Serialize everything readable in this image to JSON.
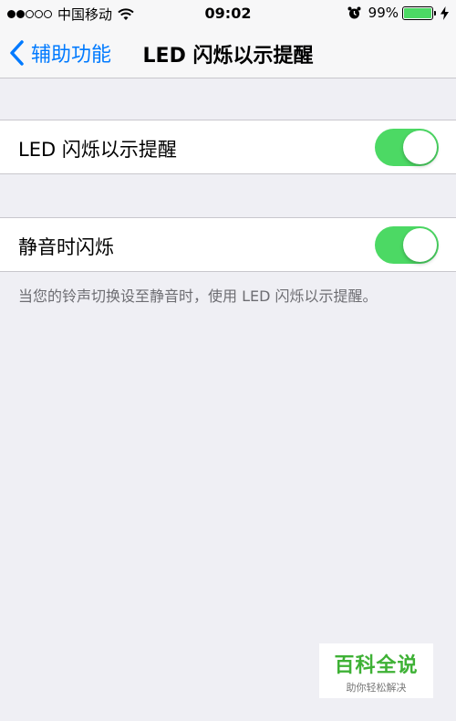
{
  "status_bar": {
    "signal_dots": [
      true,
      true,
      false,
      false,
      false
    ],
    "carrier": "中国移动",
    "time": "09:02",
    "battery_percent": "99%",
    "battery_level": 0.99,
    "icons": [
      "wifi-icon",
      "alarm-icon",
      "battery-icon",
      "charging-bolt-icon"
    ]
  },
  "nav": {
    "back_label": "辅助功能",
    "title": "LED 闪烁以示提醒"
  },
  "settings": {
    "led_flash": {
      "label": "LED 闪烁以示提醒",
      "enabled": true
    },
    "flash_on_silent": {
      "label": "静音时闪烁",
      "enabled": true
    },
    "footer": "当您的铃声切换设至静音时，使用 LED 闪烁以示提醒。"
  },
  "watermark": {
    "title": "百科全说",
    "subtitle": "助你轻松解决"
  },
  "colors": {
    "accent": "#007aff",
    "switch_on": "#4cd964",
    "background": "#efeff4",
    "watermark_green": "#3eb135"
  }
}
